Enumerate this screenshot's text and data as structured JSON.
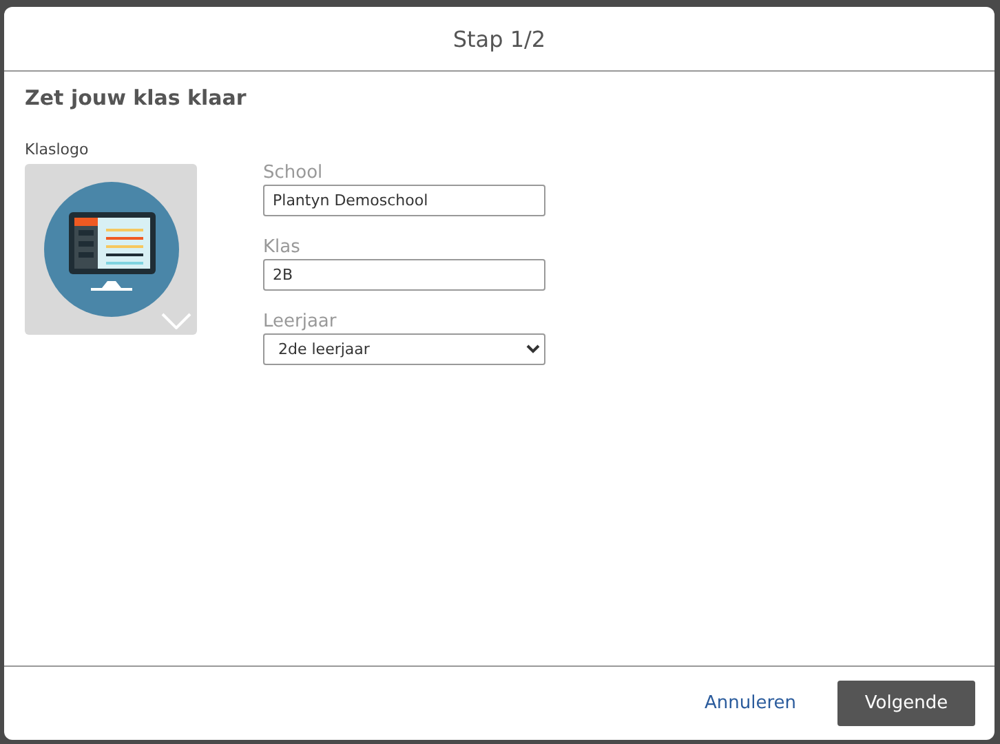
{
  "dialog": {
    "title": "Stap 1/2",
    "heading": "Zet jouw klas klaar",
    "logo": {
      "label": "Klaslogo"
    },
    "fields": [
      {
        "kind": "text",
        "label": "School",
        "value": "Plantyn Demoschool"
      },
      {
        "kind": "text",
        "label": "Klas",
        "value": "2B"
      },
      {
        "kind": "select",
        "label": "Leerjaar",
        "value": "2de leerjaar"
      }
    ],
    "buttons": [
      {
        "kind": "link",
        "label": "Annuleren"
      },
      {
        "kind": "primary",
        "label": "Volgende"
      }
    ]
  }
}
